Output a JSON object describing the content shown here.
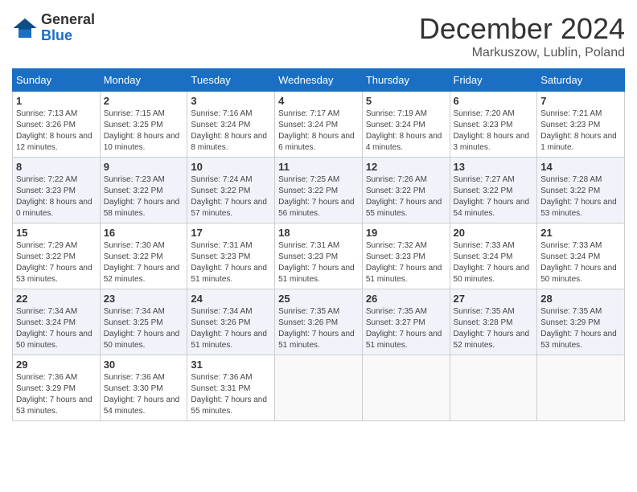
{
  "header": {
    "logo_general": "General",
    "logo_blue": "Blue",
    "month_title": "December 2024",
    "location": "Markuszow, Lublin, Poland"
  },
  "days_of_week": [
    "Sunday",
    "Monday",
    "Tuesday",
    "Wednesday",
    "Thursday",
    "Friday",
    "Saturday"
  ],
  "weeks": [
    [
      {
        "day": "1",
        "sunrise": "7:13 AM",
        "sunset": "3:26 PM",
        "daylight": "8 hours and 12 minutes."
      },
      {
        "day": "2",
        "sunrise": "7:15 AM",
        "sunset": "3:25 PM",
        "daylight": "8 hours and 10 minutes."
      },
      {
        "day": "3",
        "sunrise": "7:16 AM",
        "sunset": "3:24 PM",
        "daylight": "8 hours and 8 minutes."
      },
      {
        "day": "4",
        "sunrise": "7:17 AM",
        "sunset": "3:24 PM",
        "daylight": "8 hours and 6 minutes."
      },
      {
        "day": "5",
        "sunrise": "7:19 AM",
        "sunset": "3:24 PM",
        "daylight": "8 hours and 4 minutes."
      },
      {
        "day": "6",
        "sunrise": "7:20 AM",
        "sunset": "3:23 PM",
        "daylight": "8 hours and 3 minutes."
      },
      {
        "day": "7",
        "sunrise": "7:21 AM",
        "sunset": "3:23 PM",
        "daylight": "8 hours and 1 minute."
      }
    ],
    [
      {
        "day": "8",
        "sunrise": "7:22 AM",
        "sunset": "3:23 PM",
        "daylight": "8 hours and 0 minutes."
      },
      {
        "day": "9",
        "sunrise": "7:23 AM",
        "sunset": "3:22 PM",
        "daylight": "7 hours and 58 minutes."
      },
      {
        "day": "10",
        "sunrise": "7:24 AM",
        "sunset": "3:22 PM",
        "daylight": "7 hours and 57 minutes."
      },
      {
        "day": "11",
        "sunrise": "7:25 AM",
        "sunset": "3:22 PM",
        "daylight": "7 hours and 56 minutes."
      },
      {
        "day": "12",
        "sunrise": "7:26 AM",
        "sunset": "3:22 PM",
        "daylight": "7 hours and 55 minutes."
      },
      {
        "day": "13",
        "sunrise": "7:27 AM",
        "sunset": "3:22 PM",
        "daylight": "7 hours and 54 minutes."
      },
      {
        "day": "14",
        "sunrise": "7:28 AM",
        "sunset": "3:22 PM",
        "daylight": "7 hours and 53 minutes."
      }
    ],
    [
      {
        "day": "15",
        "sunrise": "7:29 AM",
        "sunset": "3:22 PM",
        "daylight": "7 hours and 53 minutes."
      },
      {
        "day": "16",
        "sunrise": "7:30 AM",
        "sunset": "3:22 PM",
        "daylight": "7 hours and 52 minutes."
      },
      {
        "day": "17",
        "sunrise": "7:31 AM",
        "sunset": "3:23 PM",
        "daylight": "7 hours and 51 minutes."
      },
      {
        "day": "18",
        "sunrise": "7:31 AM",
        "sunset": "3:23 PM",
        "daylight": "7 hours and 51 minutes."
      },
      {
        "day": "19",
        "sunrise": "7:32 AM",
        "sunset": "3:23 PM",
        "daylight": "7 hours and 51 minutes."
      },
      {
        "day": "20",
        "sunrise": "7:33 AM",
        "sunset": "3:24 PM",
        "daylight": "7 hours and 50 minutes."
      },
      {
        "day": "21",
        "sunrise": "7:33 AM",
        "sunset": "3:24 PM",
        "daylight": "7 hours and 50 minutes."
      }
    ],
    [
      {
        "day": "22",
        "sunrise": "7:34 AM",
        "sunset": "3:24 PM",
        "daylight": "7 hours and 50 minutes."
      },
      {
        "day": "23",
        "sunrise": "7:34 AM",
        "sunset": "3:25 PM",
        "daylight": "7 hours and 50 minutes."
      },
      {
        "day": "24",
        "sunrise": "7:34 AM",
        "sunset": "3:26 PM",
        "daylight": "7 hours and 51 minutes."
      },
      {
        "day": "25",
        "sunrise": "7:35 AM",
        "sunset": "3:26 PM",
        "daylight": "7 hours and 51 minutes."
      },
      {
        "day": "26",
        "sunrise": "7:35 AM",
        "sunset": "3:27 PM",
        "daylight": "7 hours and 51 minutes."
      },
      {
        "day": "27",
        "sunrise": "7:35 AM",
        "sunset": "3:28 PM",
        "daylight": "7 hours and 52 minutes."
      },
      {
        "day": "28",
        "sunrise": "7:35 AM",
        "sunset": "3:29 PM",
        "daylight": "7 hours and 53 minutes."
      }
    ],
    [
      {
        "day": "29",
        "sunrise": "7:36 AM",
        "sunset": "3:29 PM",
        "daylight": "7 hours and 53 minutes."
      },
      {
        "day": "30",
        "sunrise": "7:36 AM",
        "sunset": "3:30 PM",
        "daylight": "7 hours and 54 minutes."
      },
      {
        "day": "31",
        "sunrise": "7:36 AM",
        "sunset": "3:31 PM",
        "daylight": "7 hours and 55 minutes."
      },
      null,
      null,
      null,
      null
    ]
  ]
}
